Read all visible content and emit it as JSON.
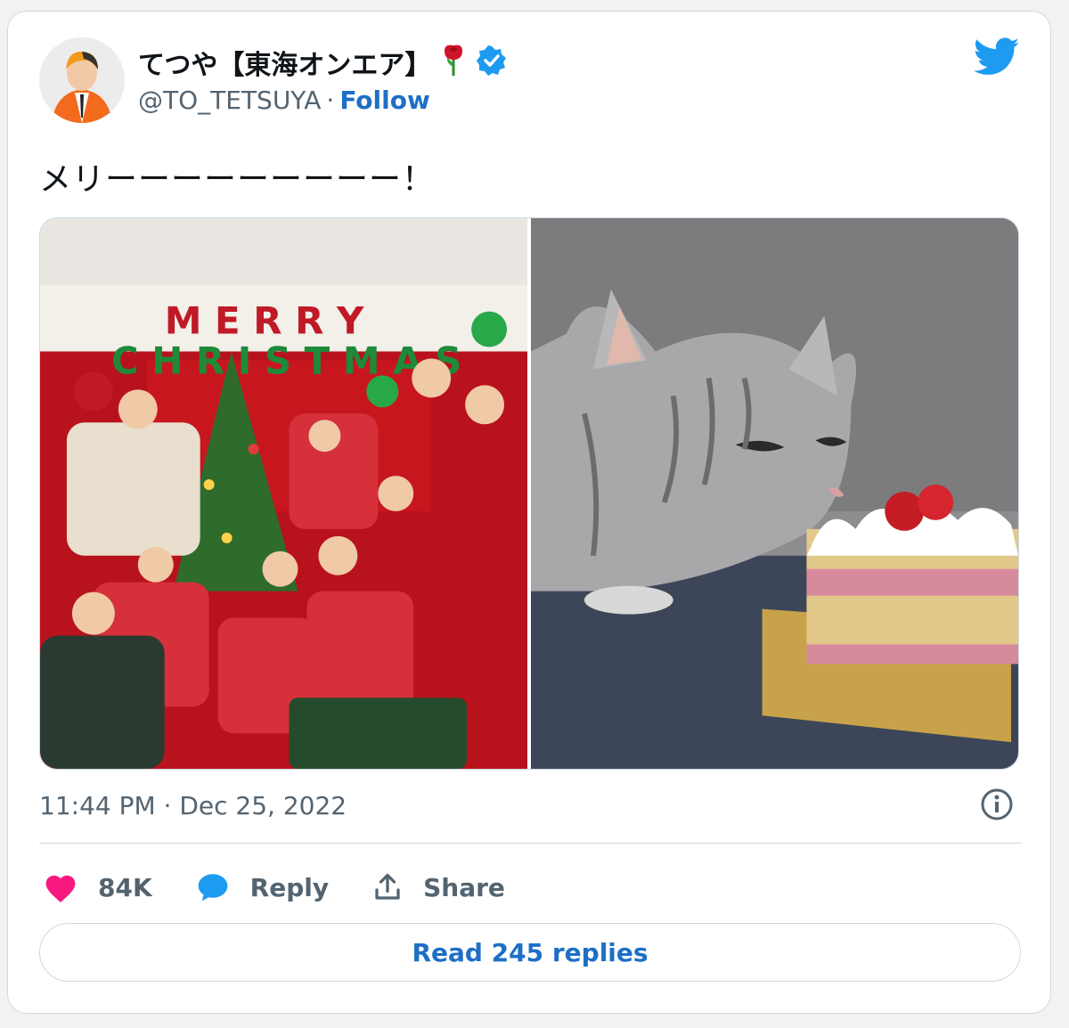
{
  "user": {
    "display_name": "てつや【東海オンエア】",
    "rose_emoji": "🌹",
    "handle": "@TO_TETSUYA",
    "separator": "·",
    "follow_label": "Follow"
  },
  "tweet": {
    "text": "メリーーーーーーーーー！",
    "timestamp": "11:44 PM · Dec 25, 2022"
  },
  "actions": {
    "like_count": "84K",
    "reply_label": "Reply",
    "share_label": "Share"
  },
  "read_replies_label": "Read 245 replies",
  "colors": {
    "twitter_blue": "#1d9bf0",
    "like_pink": "#f91880",
    "link_blue": "#1d6fc7",
    "verified_blue": "#1d9bf0"
  },
  "media": {
    "image_1_label": "MERRY CHRISTMAS",
    "image_1_icons": [
      "party-group-photo",
      "christmas-tree",
      "balloons"
    ],
    "image_2_icons": [
      "cat",
      "strawberry-cake"
    ]
  }
}
